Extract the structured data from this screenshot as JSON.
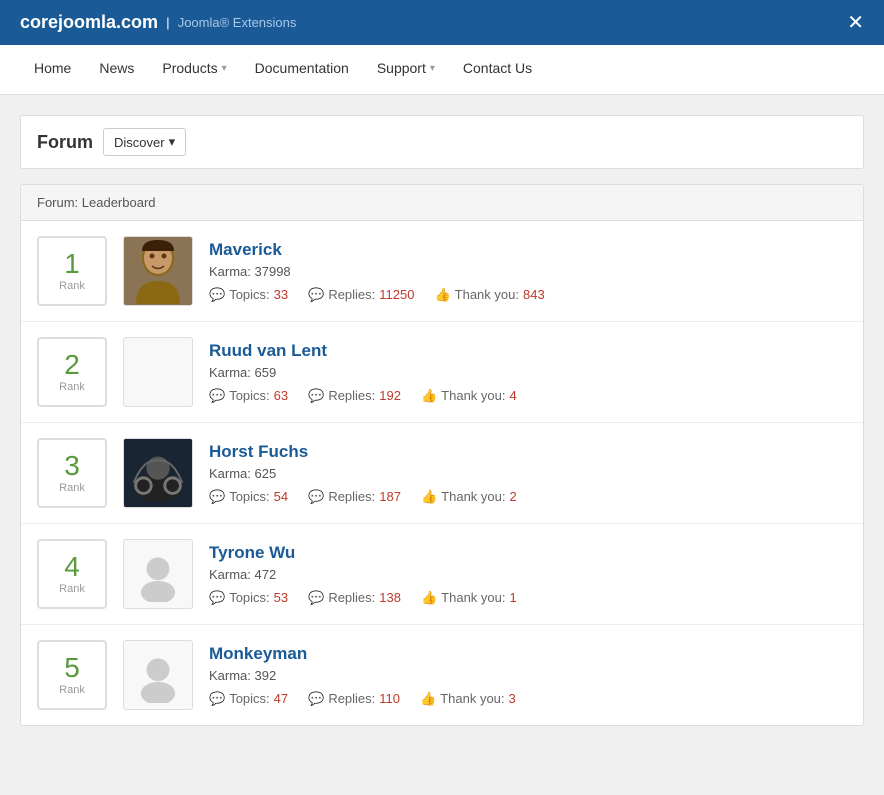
{
  "header": {
    "logo_text": "corejoomla.com",
    "separator": "|",
    "tagline": "Joomla® Extensions"
  },
  "nav": {
    "items": [
      {
        "label": "Home",
        "active": false,
        "has_arrow": false
      },
      {
        "label": "News",
        "active": false,
        "has_arrow": false
      },
      {
        "label": "Products",
        "active": false,
        "has_arrow": true
      },
      {
        "label": "Documentation",
        "active": false,
        "has_arrow": false
      },
      {
        "label": "Support",
        "active": false,
        "has_arrow": true
      },
      {
        "label": "Contact Us",
        "active": false,
        "has_arrow": false
      }
    ]
  },
  "forum_title": "Forum",
  "discover_label": "Discover",
  "leaderboard_header": "Forum: Leaderboard",
  "rank_label": "Rank",
  "users": [
    {
      "rank": "1",
      "name": "Maverick",
      "karma": "Karma: 37998",
      "topics": "33",
      "replies": "11250",
      "thankyou": "843",
      "avatar_type": "maverick"
    },
    {
      "rank": "2",
      "name": "Ruud van Lent",
      "karma": "Karma: 659",
      "topics": "63",
      "replies": "192",
      "thankyou": "4",
      "avatar_type": "empty"
    },
    {
      "rank": "3",
      "name": "Horst Fuchs",
      "karma": "Karma: 625",
      "topics": "54",
      "replies": "187",
      "thankyou": "2",
      "avatar_type": "horst"
    },
    {
      "rank": "4",
      "name": "Tyrone Wu",
      "karma": "Karma: 472",
      "topics": "53",
      "replies": "138",
      "thankyou": "1",
      "avatar_type": "person"
    },
    {
      "rank": "5",
      "name": "Monkeyman",
      "karma": "Karma: 392",
      "topics": "47",
      "replies": "110",
      "thankyou": "3",
      "avatar_type": "person"
    }
  ],
  "stats": {
    "topics_label": "Topics:",
    "replies_label": "Replies:",
    "thankyou_label": "Thank you:"
  }
}
